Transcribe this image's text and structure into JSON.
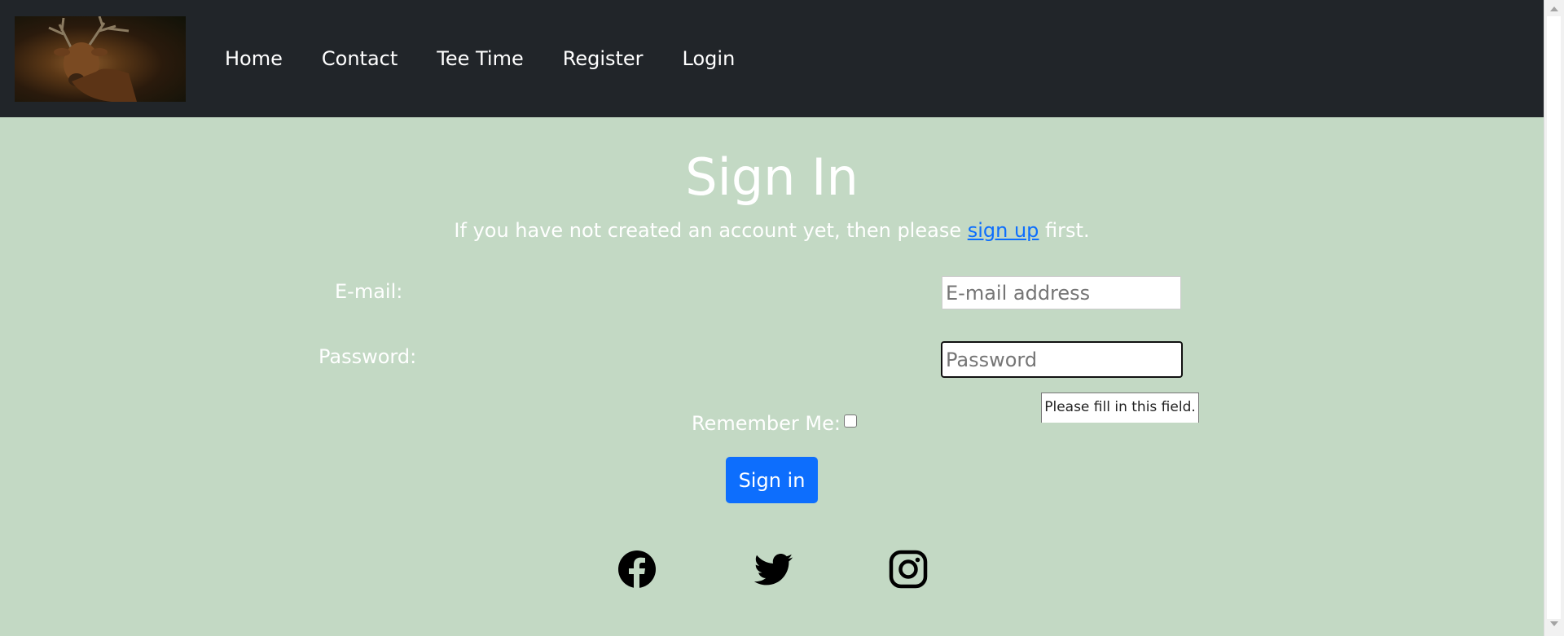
{
  "nav": {
    "links": [
      "Home",
      "Contact",
      "Tee Time",
      "Register",
      "Login"
    ]
  },
  "main": {
    "title": "Sign In",
    "subtitle_before": "If you have not created an account yet, then please ",
    "subtitle_link": "sign up",
    "subtitle_after": " first.",
    "email_label": "E-mail:",
    "email_placeholder": "E-mail address",
    "password_label": "Password:",
    "password_placeholder": "Password",
    "validation_tooltip": "Please fill in this field.",
    "remember_label": "Remember Me:",
    "remember_checked": false,
    "signin_button": "Sign in"
  },
  "social": {
    "icons": [
      "facebook-icon",
      "twitter-icon",
      "instagram-icon"
    ]
  },
  "colors": {
    "navbar_bg": "#212529",
    "page_bg": "#c3d9c4",
    "primary": "#0d6efd",
    "link": "#0d6efd"
  }
}
